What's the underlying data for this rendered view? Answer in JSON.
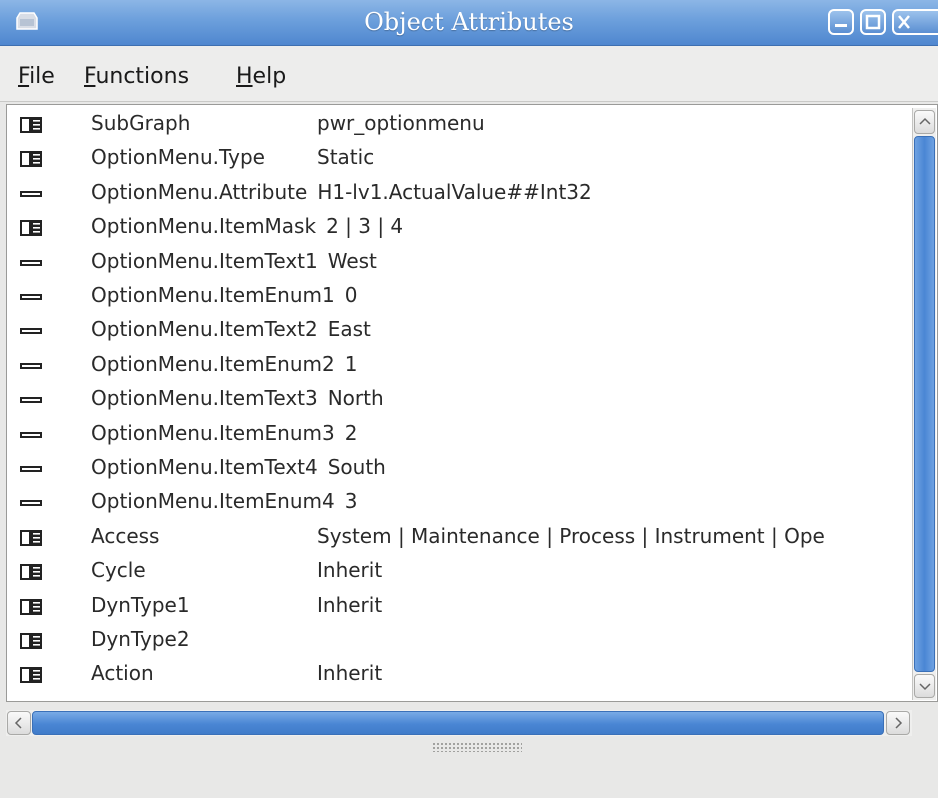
{
  "window": {
    "title": "Object Attributes",
    "colors": {
      "titlebar": "#6c9fdc",
      "selection": "#4a86d4",
      "background": "#e8e8e7"
    }
  },
  "menu": {
    "items": [
      {
        "mnemonic": "F",
        "rest": "ile"
      },
      {
        "mnemonic": "F",
        "rest": "unctions"
      },
      {
        "mnemonic": "H",
        "rest": "elp"
      }
    ]
  },
  "attributes": [
    {
      "icon": "folder-icon",
      "name": "SubGraph",
      "value": "pwr_optionmenu",
      "layout": "col"
    },
    {
      "icon": "folder-icon",
      "name": "OptionMenu.Type",
      "value": "Static",
      "layout": "col"
    },
    {
      "icon": "dash-icon",
      "name": "OptionMenu.Attribute",
      "value": "H1-lv1.ActualValue##Int32",
      "layout": "inline"
    },
    {
      "icon": "folder-icon",
      "name": "OptionMenu.ItemMask",
      "value": "2 | 3 | 4",
      "layout": "inline"
    },
    {
      "icon": "dash-icon",
      "name": "OptionMenu.ItemText1",
      "value": "West",
      "layout": "inline"
    },
    {
      "icon": "dash-icon",
      "name": "OptionMenu.ItemEnum1",
      "value": "0",
      "layout": "inline"
    },
    {
      "icon": "dash-icon",
      "name": "OptionMenu.ItemText2",
      "value": "East",
      "layout": "inline"
    },
    {
      "icon": "dash-icon",
      "name": "OptionMenu.ItemEnum2",
      "value": "1",
      "layout": "inline"
    },
    {
      "icon": "dash-icon",
      "name": "OptionMenu.ItemText3",
      "value": "North",
      "layout": "inline"
    },
    {
      "icon": "dash-icon",
      "name": "OptionMenu.ItemEnum3",
      "value": "2",
      "layout": "inline"
    },
    {
      "icon": "dash-icon",
      "name": "OptionMenu.ItemText4",
      "value": "South",
      "layout": "inline"
    },
    {
      "icon": "dash-icon",
      "name": "OptionMenu.ItemEnum4",
      "value": "3",
      "layout": "inline"
    },
    {
      "icon": "folder-icon",
      "name": "Access",
      "value": "System | Maintenance | Process | Instrument | Ope",
      "layout": "col"
    },
    {
      "icon": "folder-icon",
      "name": "Cycle",
      "value": "Inherit",
      "layout": "col"
    },
    {
      "icon": "folder-icon",
      "name": "DynType1",
      "value": "Inherit",
      "layout": "col"
    },
    {
      "icon": "folder-icon",
      "name": "DynType2",
      "value": "",
      "layout": "col"
    },
    {
      "icon": "folder-icon",
      "name": "Action",
      "value": "Inherit",
      "layout": "col"
    }
  ]
}
